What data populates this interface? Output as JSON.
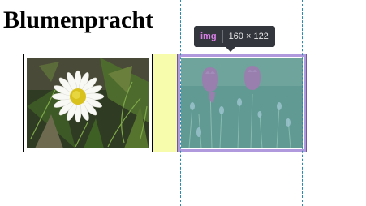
{
  "page": {
    "heading": "Blumenpracht"
  },
  "images": [
    {
      "subject": "daisy-photo"
    },
    {
      "subject": "tulips-photo"
    }
  ],
  "inspector_tooltip": {
    "tag": "img",
    "size": "160 × 122"
  },
  "colors": {
    "margin_highlight": "#f6fa9e",
    "padding_highlight": "#9678d2",
    "content_highlight": "#6fa8dc",
    "guide_line": "#2a8ab0",
    "tooltip_bg": "#33373d",
    "tooltip_tag": "#d97fe7"
  }
}
